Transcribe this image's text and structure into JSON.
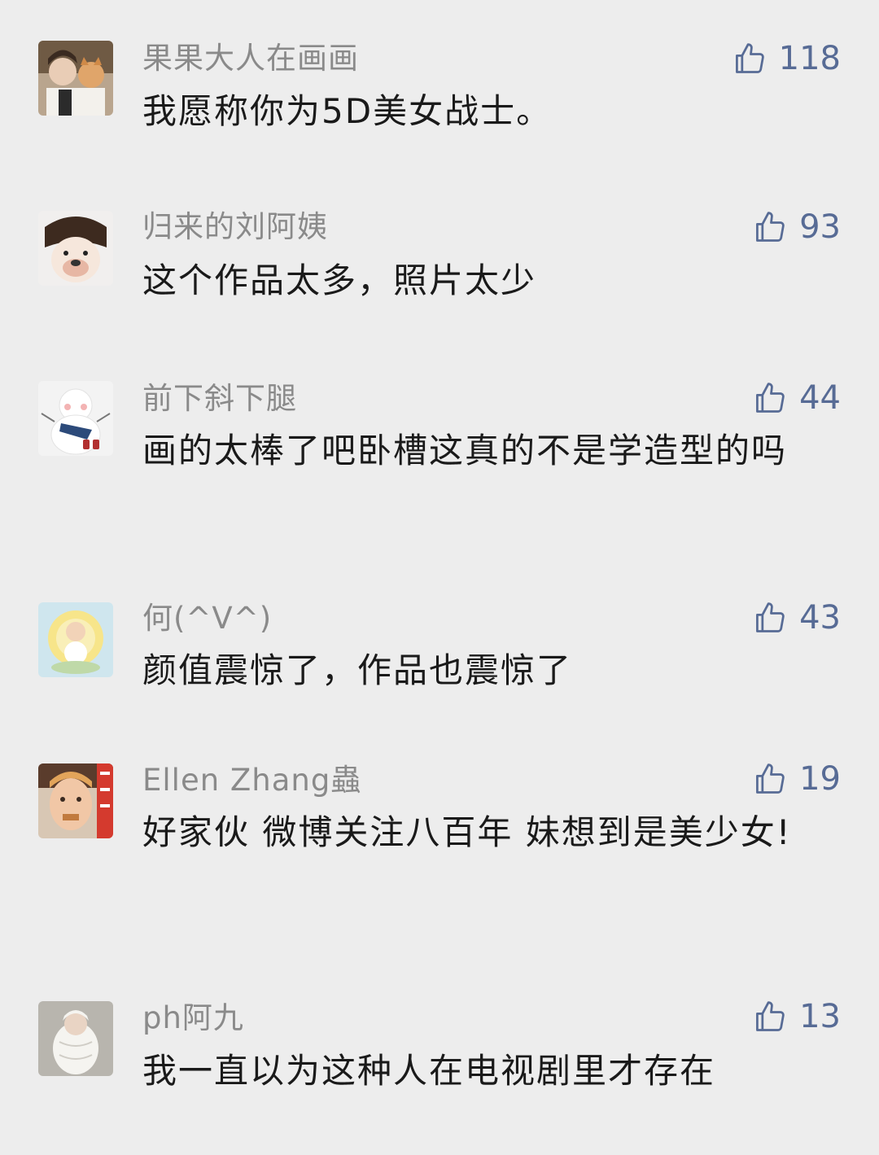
{
  "comments": [
    {
      "nickname": "果果大人在画画",
      "text": "我愿称你为5D美女战士。",
      "likes": "118"
    },
    {
      "nickname": "归来的刘阿姨",
      "text": "这个作品太多，照片太少",
      "likes": "93"
    },
    {
      "nickname": "前下斜下腿",
      "text": "画的太棒了吧卧槽这真的不是学造型的吗",
      "likes": "44"
    },
    {
      "nickname": "何(^V^)",
      "text": "颜值震惊了，作品也震惊了",
      "likes": "43"
    },
    {
      "nickname": "Ellen Zhang蟲",
      "text": "好家伙 微博关注八百年 妹想到是美少女!",
      "likes": "19"
    },
    {
      "nickname": "ph阿九",
      "text": "我一直以为这种人在电视剧里才存在",
      "likes": "13"
    }
  ],
  "colors": {
    "background": "#ededed",
    "nickname": "#8a8a8a",
    "text": "#1a1a1a",
    "like": "#576b95"
  },
  "icons": {
    "like": "thumbs-up-icon"
  }
}
